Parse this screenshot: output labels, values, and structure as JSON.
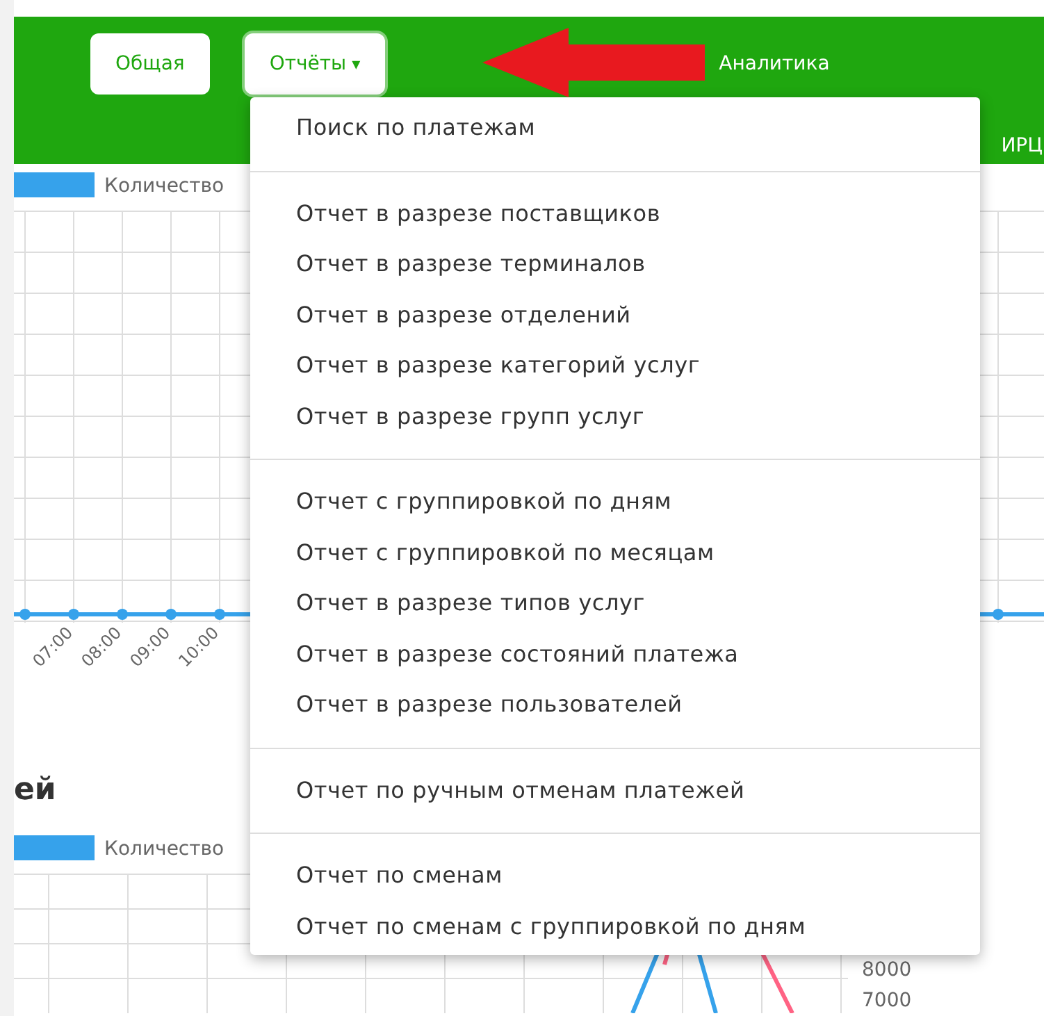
{
  "nav": {
    "tabs": [
      {
        "kind": "button",
        "label": "Общая"
      },
      {
        "kind": "dropdown",
        "label": "Отчёты",
        "caret": "▾",
        "expanded": true
      },
      {
        "kind": "link",
        "label": "Аналитика"
      }
    ],
    "sub_label": "ИРЦ"
  },
  "dropdown": {
    "groups": [
      [
        "Поиск по платежам"
      ],
      [
        "Отчет в разрезе поставщиков",
        "Отчет в разрезе терминалов",
        "Отчет в разрезе отделений",
        "Отчет в разрезе категорий услуг",
        "Отчет в разрезе групп услуг"
      ],
      [
        "Отчет с группировкой по дням",
        "Отчет с группировкой по месяцам",
        "Отчет в разрезе типов услуг",
        "Отчет в разрезе состояний платежа",
        "Отчет в разрезе пользователей"
      ],
      [
        "Отчет по ручным отменам платежей"
      ],
      [
        "Отчет по сменам",
        "Отчет по сменам с группировкой по дням"
      ]
    ]
  },
  "chart_1": {
    "legend": "Количество",
    "x_labels": [
      "07:00",
      "08:00",
      "09:00",
      "10:00"
    ]
  },
  "section_title": "ей",
  "chart_2": {
    "legend": "Количество",
    "y_labels": [
      "8000",
      "7000"
    ]
  }
}
